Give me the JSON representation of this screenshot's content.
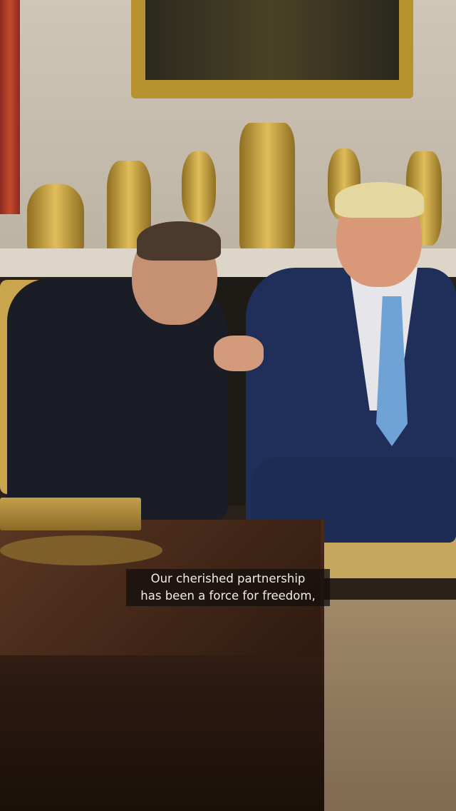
{
  "caption": {
    "line1": "Our cherished partnership",
    "line2": "has been a force for freedom,"
  }
}
